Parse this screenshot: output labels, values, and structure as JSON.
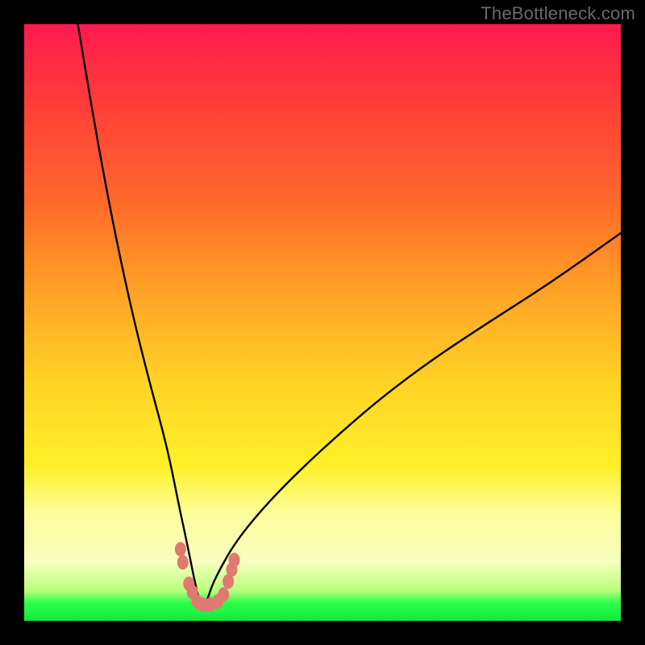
{
  "watermark": "TheBottleneck.com",
  "colors": {
    "frame": "#000000",
    "curve": "#000000",
    "marker": "#e07a70",
    "gradient_stops": [
      "#ff1a4d",
      "#ff3a3a",
      "#ff6a2a",
      "#ffa326",
      "#ffd326",
      "#fff028",
      "#fdfd9a",
      "#f7ffbf",
      "#b8ff7a",
      "#2bff4a",
      "#14e83e"
    ]
  },
  "chart_data": {
    "type": "line",
    "title": "",
    "xlabel": "",
    "ylabel": "",
    "x_range": [
      0,
      100
    ],
    "y_range": [
      0,
      100
    ],
    "note": "Axes are unlabeled in the source image; values below are in % of plot area (x left→right, y bottom→top). The curve is a sharp V with its minimum at ≈ (30, 2) reaching 0%, the left branch rising steeply to 100% near x≈9, and the right branch rising more gently to ≈65% at x=100.",
    "series": [
      {
        "name": "bottleneck-curve",
        "x": [
          9,
          12,
          15,
          18,
          21,
          24,
          26,
          27.5,
          28.5,
          29.3,
          30,
          30.7,
          31.5,
          33,
          35,
          38,
          42,
          47,
          53,
          60,
          68,
          77,
          88,
          100
        ],
        "y": [
          100,
          82,
          66,
          52,
          40,
          29,
          19,
          12,
          7,
          3.5,
          2,
          3.5,
          6,
          9,
          12.5,
          16.5,
          21,
          26,
          31.5,
          37.5,
          43.5,
          49.5,
          56.5,
          65
        ]
      }
    ],
    "markers": {
      "name": "highlighted-points",
      "shape": "rounded-rect",
      "color": "#e07a70",
      "points_xy_pct": [
        [
          26.2,
          12.0
        ],
        [
          26.6,
          9.8
        ],
        [
          27.6,
          6.2
        ],
        [
          28.2,
          4.8
        ],
        [
          29.0,
          3.2
        ],
        [
          30.0,
          2.7
        ],
        [
          31.2,
          2.7
        ],
        [
          32.4,
          3.2
        ],
        [
          33.4,
          4.4
        ],
        [
          34.2,
          6.6
        ],
        [
          34.8,
          8.6
        ],
        [
          35.2,
          10.2
        ]
      ]
    }
  }
}
